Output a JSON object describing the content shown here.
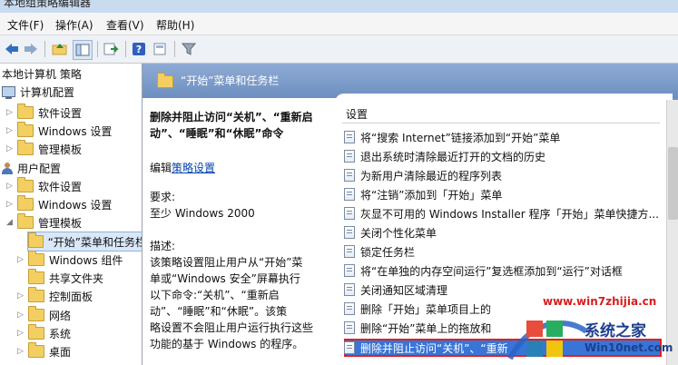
{
  "window": {
    "title": "本地组策略编辑器"
  },
  "menu": [
    "文件(F)",
    "操作(A)",
    "查看(V)",
    "帮助(H)"
  ],
  "toolbar_icons": [
    "back-arrow-icon",
    "forward-arrow-icon",
    "up-folder-icon",
    "show-hide-tree-icon",
    "export-list-icon",
    "help-icon",
    "properties-icon",
    "filter-icon"
  ],
  "tree": {
    "root": "本地计算机 策略",
    "computer_config": "计算机配置",
    "c_software": "软件设置",
    "c_windows": "Windows 设置",
    "c_templates": "管理模板",
    "user_config": "用户配置",
    "u_software": "软件设置",
    "u_windows": "Windows 设置",
    "u_templates": "管理模板",
    "start_menu": "“开始”菜单和任务栏",
    "win_components": "Windows 组件",
    "shared_folders": "共享文件夹",
    "control_panel": "控制面板",
    "network": "网络",
    "system": "系统",
    "desktop": "桌面"
  },
  "header": {
    "title": "“开始”菜单和任务栏"
  },
  "description": {
    "title_lines": [
      "删除并阻止访问“关机”、“重新启",
      "动”、“睡眠”和“休眠”命令"
    ],
    "edit_prefix": "编辑",
    "edit_link": "策略设置",
    "requirements_label": "要求:",
    "requirements_value": "至少 Windows 2000",
    "desc_label": "描述:",
    "desc_lines": [
      "该策略设置阻止用户从“开始”菜",
      "单或“Windows 安全”屏幕执行",
      "以下命令:“关机”、“重新启",
      "动”、“睡眠”和“休眠”。该策",
      "略设置不会阻止用户运行执行这些",
      "功能的基于 Windows 的程序。"
    ]
  },
  "list": {
    "header": "设置",
    "items": [
      "将“搜索 Internet”链接添加到“开始”菜单",
      "退出系统时清除最近打开的文档的历史",
      "为新用户清除最近的程序列表",
      "将“注销”添加到「开始」菜单",
      "灰显不可用的 Windows Installer 程序「开始」菜单快捷方...",
      "关闭个性化菜单",
      "锁定任务栏",
      "将“在单独的内存空间运行”复选框添加到“运行”对话框",
      "关闭通知区域清理",
      "删除「开始」菜单项目上的",
      "删除“开始”菜单上的拖放和",
      "删除并阻止访问“关机”、“重新"
    ],
    "selected_index": 11
  },
  "watermark": {
    "url": "www.win7zhijia.cn",
    "brand": "系统之家",
    "site": "Win10net.com"
  }
}
